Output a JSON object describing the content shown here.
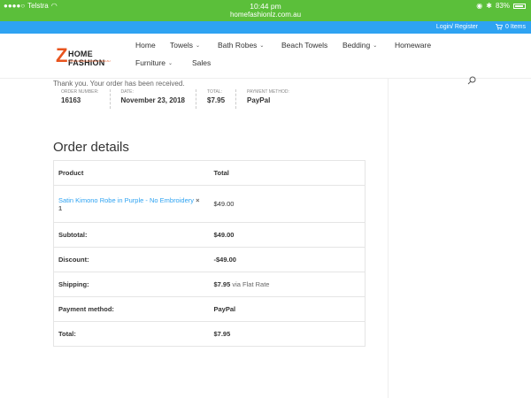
{
  "status_bar": {
    "carrier": "Telstra",
    "time": "10:44 pm",
    "url": "homefashionlz.com.au",
    "battery": "83%"
  },
  "top_bar": {
    "login_label": "Login/ Register",
    "cart_label": "0 Items"
  },
  "logo": {
    "letter": "Z",
    "name": "HOME FASHION",
    "tagline": "WWW.HOMEFASHIONLZ.COM.AU"
  },
  "nav": {
    "items": [
      {
        "label": "Home"
      },
      {
        "label": "Towels"
      },
      {
        "label": "Bath Robes"
      },
      {
        "label": "Beach Towels"
      },
      {
        "label": "Bedding"
      },
      {
        "label": "Homeware"
      },
      {
        "label": "Furniture"
      },
      {
        "label": "Sales"
      }
    ]
  },
  "order": {
    "received_text": "Thank you. Your order has been received.",
    "overview": [
      {
        "key": "ORDER NUMBER:",
        "value": "16163"
      },
      {
        "key": "DATE:",
        "value": "November 23, 2018"
      },
      {
        "key": "TOTAL:",
        "value": "$7.95"
      },
      {
        "key": "PAYMENT METHOD:",
        "value": "PayPal"
      }
    ]
  },
  "details": {
    "title": "Order details",
    "header": {
      "product": "Product",
      "total": "Total"
    },
    "product_name": "Satin Kimono Robe in Purple - No Embroidery",
    "product_qty": "× 1",
    "product_total": "$49.00",
    "rows": [
      {
        "label": "Subtotal:",
        "value": "$49.00",
        "suffix": ""
      },
      {
        "label": "Discount:",
        "value": "-$49.00",
        "suffix": ""
      },
      {
        "label": "Shipping:",
        "value": "$7.95",
        "suffix": "via Flat Rate"
      },
      {
        "label": "Payment method:",
        "value": "PayPal",
        "suffix": ""
      },
      {
        "label": "Total:",
        "value": "$7.95",
        "suffix": ""
      }
    ]
  },
  "colors": {
    "status_bar": "#5bbf3a",
    "top_bar": "#2ea3f2",
    "logo_accent": "#e8541e",
    "link": "#2ea3f2"
  }
}
